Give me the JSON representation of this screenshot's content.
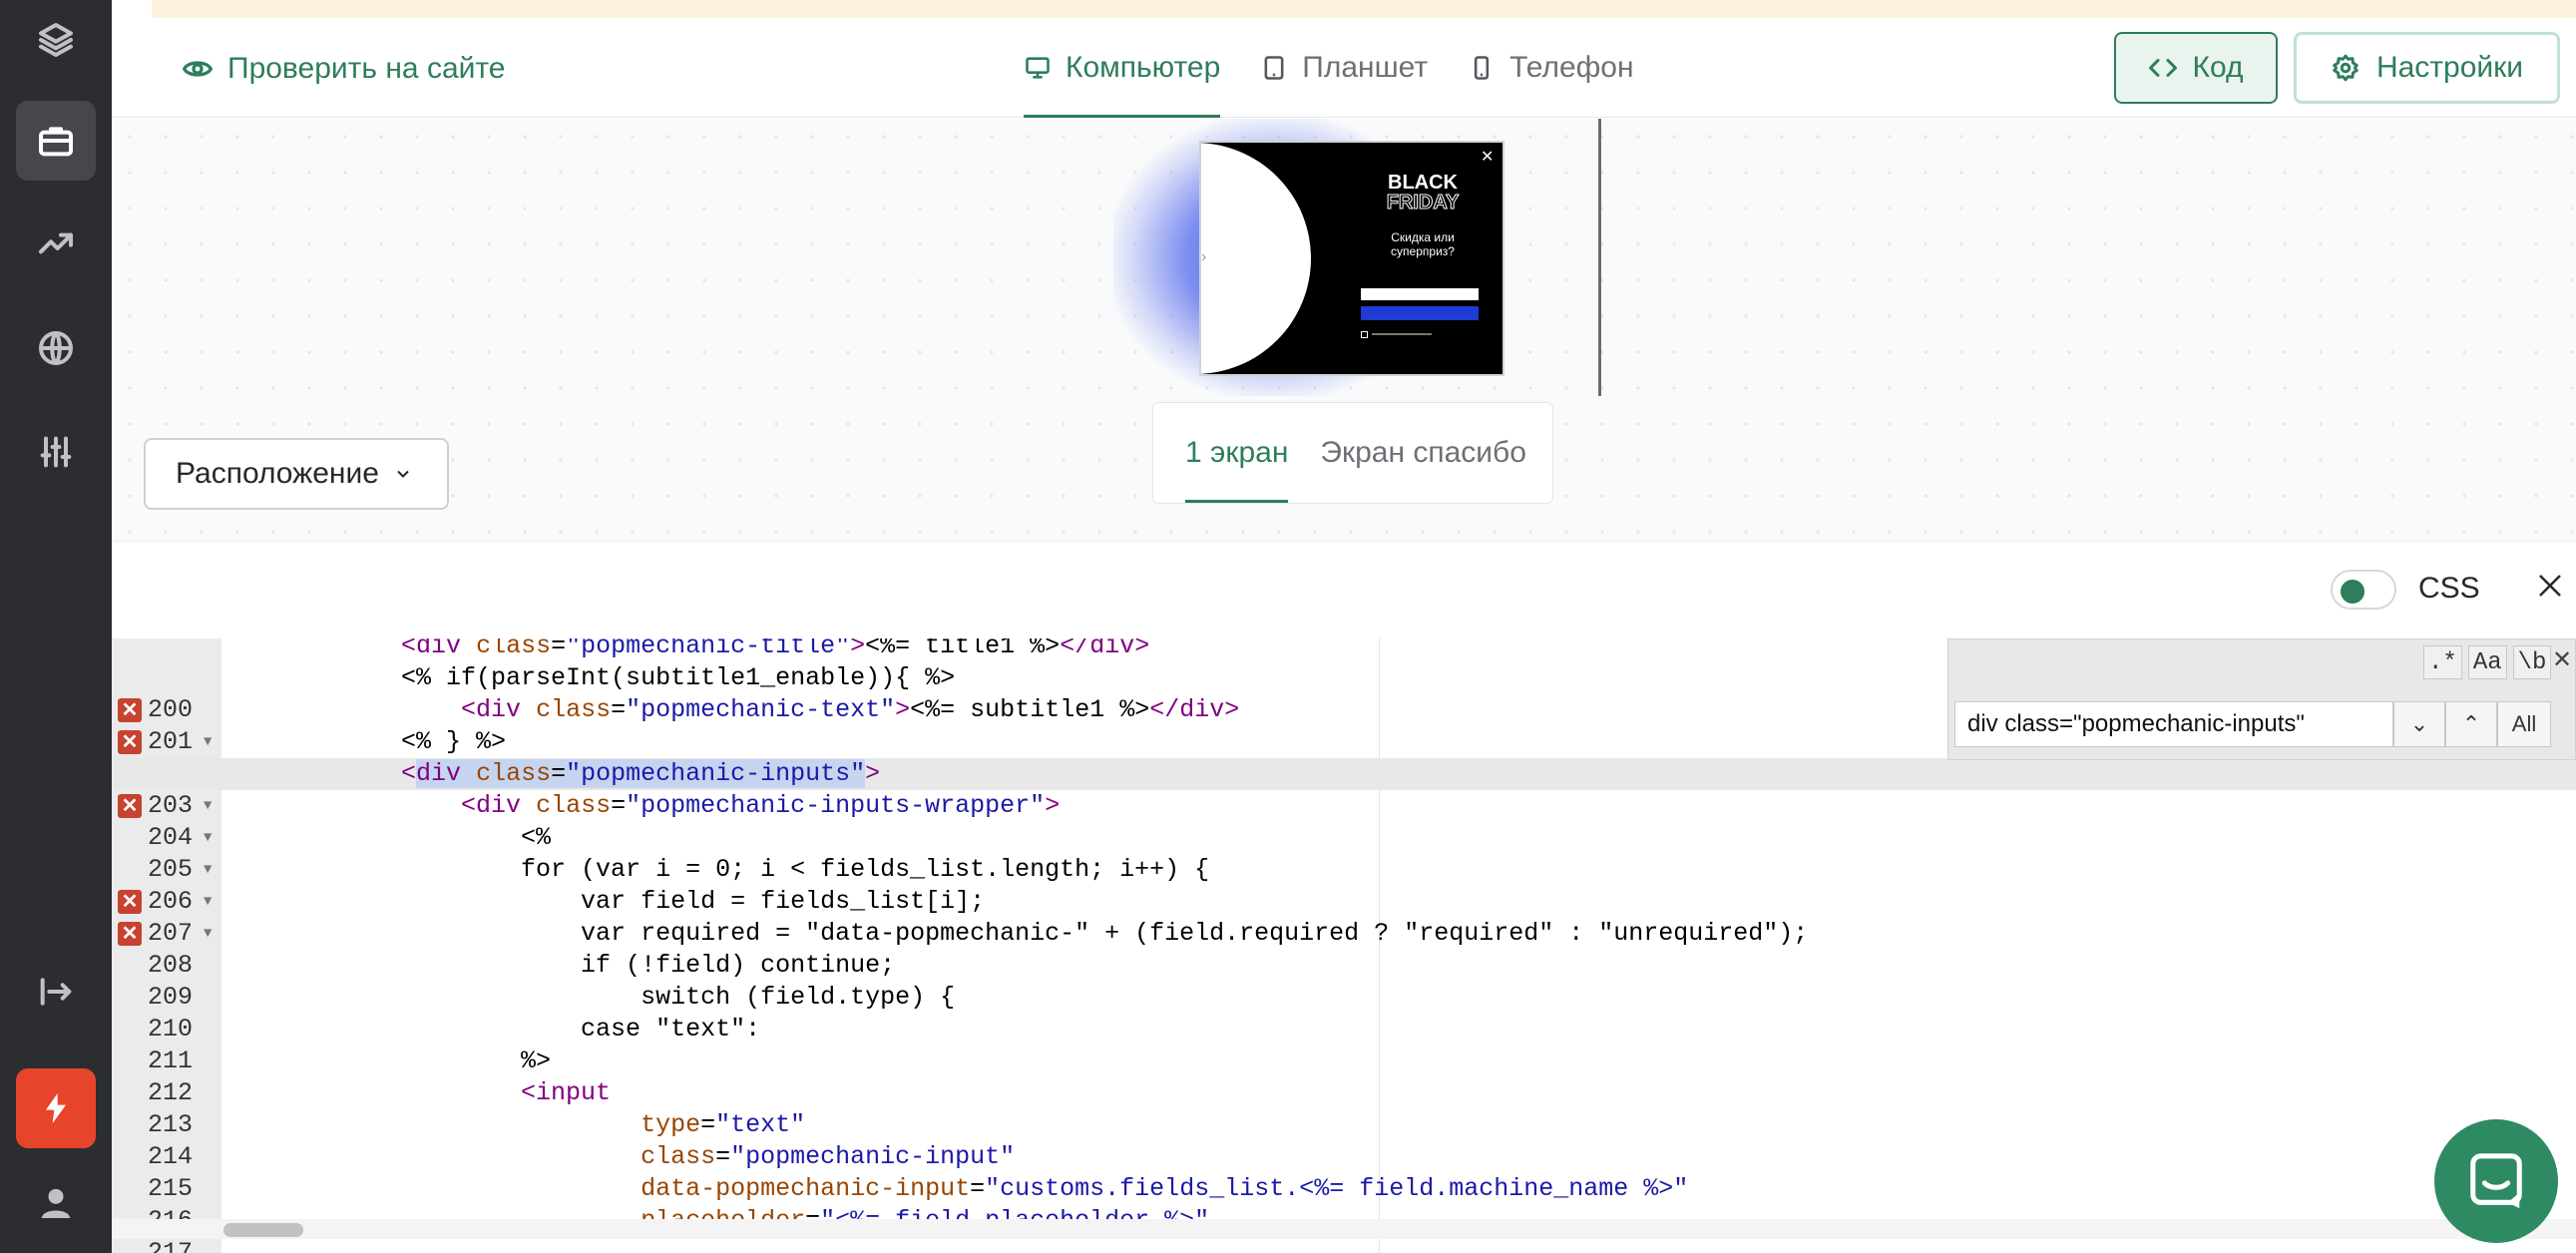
{
  "sidebar": {
    "items": [
      {
        "icon": "layers-icon"
      },
      {
        "icon": "briefcase-icon",
        "active": true
      },
      {
        "icon": "trending-up-icon"
      },
      {
        "icon": "globe-icon"
      },
      {
        "icon": "sliders-icon"
      }
    ],
    "bottom": [
      {
        "icon": "logout-icon"
      },
      {
        "icon": "bolt-icon"
      },
      {
        "icon": "user-icon"
      }
    ]
  },
  "topbar": {
    "check_site_label": "Проверить на сайте",
    "devices": [
      {
        "label": "Компьютер",
        "active": true
      },
      {
        "label": "Планшет",
        "active": false
      },
      {
        "label": "Телефон",
        "active": false
      }
    ],
    "code_label": "Код",
    "settings_label": "Настройки"
  },
  "preview": {
    "popup": {
      "title_line1": "BLACK",
      "title_line2": "FRIDAY",
      "subtitle": "Скидка или суперприз?",
      "close_glyph": "✕"
    },
    "screens": [
      {
        "label": "1 экран",
        "active": true
      },
      {
        "label": "Экран спасибо",
        "active": false
      }
    ],
    "layout_label": "Расположение"
  },
  "code_panel": {
    "mode_label": "CSS",
    "toggle_on": true,
    "search": {
      "value": "div class=\"popmechanic-inputs\"",
      "options": [
        ".*",
        "Aa",
        "\\b"
      ],
      "all_label": "All"
    }
  },
  "colors": {
    "accent": "#2e7d5b",
    "sidebar_bg": "#2c2d31",
    "bolt_bg": "#e6452b",
    "error": "#c7432f"
  }
}
